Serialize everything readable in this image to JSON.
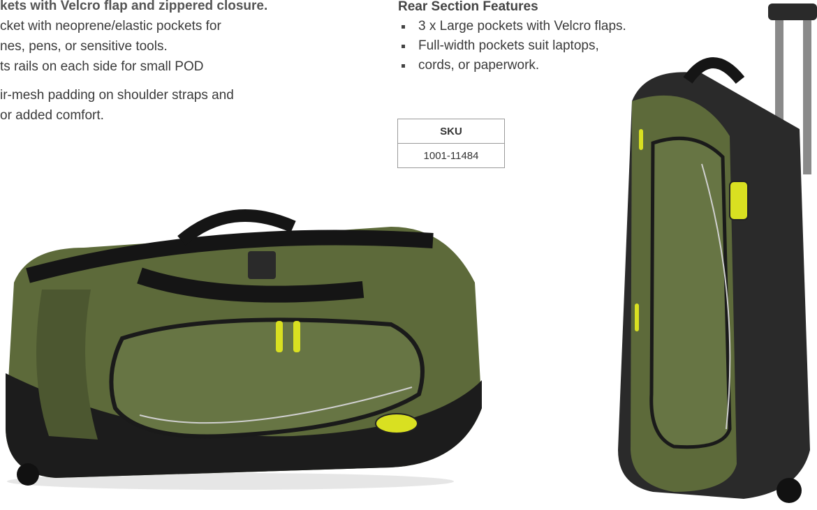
{
  "left_text": {
    "line0": "kets with Velcro flap and zippered closure.",
    "line1": "cket with neoprene/elastic pockets for",
    "line2": "nes, pens, or sensitive tools.",
    "line3": "ts rails on each side for small POD",
    "line4": "ir-mesh padding on shoulder straps and",
    "line5": "or added comfort."
  },
  "rear_section": {
    "title": "Rear Section Features",
    "items": [
      "3 x Large pockets with Velcro flaps.",
      "Full-width pockets suit laptops,",
      "cords, or paperwork."
    ]
  },
  "sku_table": {
    "header": "SKU",
    "value": "1001-11484"
  },
  "colors": {
    "bag_green": "#5d6a3a",
    "bag_black": "#1c1c1c",
    "accent_yellow": "#d9e021",
    "text": "#3a3a3a"
  },
  "images": {
    "duffel_alt": "Green and black wheeled duffel bag with black straps",
    "upright_alt": "Green and black wheeled bag standing upright with telescopic handle"
  }
}
